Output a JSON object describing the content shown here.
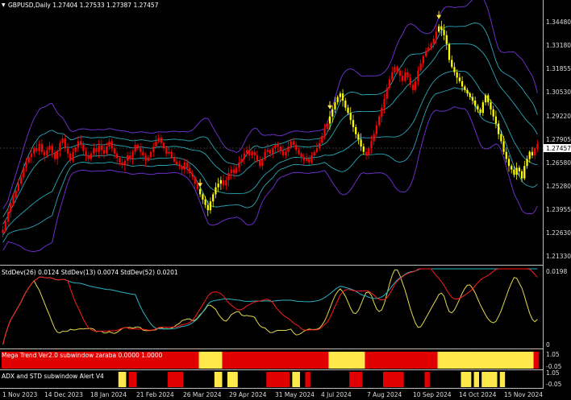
{
  "header": {
    "symbol_info": "GBPUSD,Daily  1.27404 1.27533 1.27387 1.27457"
  },
  "price_scale": {
    "labels": [
      "1.34480",
      "1.33180",
      "1.31855",
      "1.30530",
      "1.29220",
      "1.27905",
      "1.26580",
      "1.25280",
      "1.23955",
      "1.22630",
      "1.21330"
    ],
    "current_price": "1.27457"
  },
  "stddev_panel": {
    "label": "StdDev(26) 0.0124  StdDev(13) 0.0074  StdDev(52) 0.0201",
    "scale_top": "0.0198",
    "scale_bottom": "0"
  },
  "mega_trend_panel": {
    "label": "Mega Trend Ver2.0 subwindow zaraba 0.0000 1.0000",
    "scale_top": "1.05",
    "scale_bottom": "-0.05"
  },
  "adx_panel": {
    "label": "ADX and STD subwindow Alert V4",
    "scale_top": "1.05",
    "scale_bottom": "-0.05"
  },
  "time_axis": {
    "labels": [
      "1 Nov 2023",
      "14 Dec 2023",
      "18 Jan 2024",
      "21 Feb 2024",
      "26 Mar 2024",
      "29 Apr 2024",
      "31 May 2024",
      "4 Jul 2024",
      "7 Aug 2024",
      "10 Sep 2024",
      "14 Oct 2024",
      "15 Nov 2024"
    ]
  },
  "colors": {
    "background": "#000000",
    "bull_candle": "#ff0000",
    "bear_candle": "#ffff00",
    "outer_band": "#6a2fc7",
    "middle_band": "#2aa6b8",
    "inner_band": "#2aa6b8",
    "stddev26": "#ff1a1a",
    "stddev13": "#e0d84a",
    "stddev52": "#2bb3c4",
    "mega_red": "#e00000",
    "mega_yellow": "#ffe94a",
    "price_tag_bg": "#ffffff"
  },
  "chart_data": {
    "type": "candlestick",
    "ylim": [
      1.2075,
      1.3495
    ],
    "closes": [
      1.226,
      1.2305,
      1.236,
      1.241,
      1.244,
      1.248,
      1.252,
      1.2555,
      1.261,
      1.264,
      1.267,
      1.269,
      1.272,
      1.2705,
      1.2745,
      1.27,
      1.268,
      1.271,
      1.2735,
      1.2695,
      1.266,
      1.2705,
      1.275,
      1.2775,
      1.272,
      1.269,
      1.265,
      1.27,
      1.2725,
      1.276,
      1.274,
      1.2705,
      1.268,
      1.266,
      1.269,
      1.272,
      1.27,
      1.2735,
      1.271,
      1.269,
      1.273,
      1.276,
      1.272,
      1.269,
      1.2665,
      1.264,
      1.2625,
      1.265,
      1.268,
      1.266,
      1.27,
      1.274,
      1.272,
      1.27,
      1.268,
      1.265,
      1.267,
      1.27,
      1.273,
      1.276,
      1.278,
      1.275,
      1.272,
      1.269,
      1.27,
      1.267,
      1.2645,
      1.263,
      1.262,
      1.26,
      1.264,
      1.261,
      1.258,
      1.256,
      1.252,
      1.249,
      1.246,
      1.243,
      1.24,
      1.237,
      1.242,
      1.246,
      1.25,
      1.252,
      1.254,
      1.251,
      1.254,
      1.258,
      1.26,
      1.258,
      1.261,
      1.264,
      1.266,
      1.269,
      1.271,
      1.268,
      1.27,
      1.268,
      1.265,
      1.262,
      1.266,
      1.27,
      1.271,
      1.269,
      1.272,
      1.274,
      1.273,
      1.2705,
      1.268,
      1.27,
      1.273,
      1.276,
      1.274,
      1.271,
      1.269,
      1.267,
      1.265,
      1.266,
      1.264,
      1.268,
      1.27,
      1.272,
      1.275,
      1.279,
      1.283,
      1.286,
      1.29,
      1.294,
      1.298,
      1.301,
      1.303,
      1.299,
      1.295,
      1.292,
      1.288,
      1.284,
      1.28,
      1.277,
      1.273,
      1.27,
      1.268,
      1.272,
      1.276,
      1.28,
      1.285,
      1.29,
      1.295,
      1.3,
      1.306,
      1.311,
      1.315,
      1.318,
      1.316,
      1.313,
      1.31,
      1.315,
      1.312,
      1.308,
      1.305,
      1.31,
      1.316,
      1.32,
      1.324,
      1.327,
      1.329,
      1.331,
      1.334,
      1.338,
      1.341,
      1.339,
      1.336,
      1.331,
      1.322,
      1.318,
      1.315,
      1.312,
      1.31,
      1.307,
      1.305,
      1.303,
      1.301,
      1.299,
      1.296,
      1.294,
      1.292,
      1.298,
      1.302,
      1.298,
      1.294,
      1.29,
      1.286,
      1.28,
      1.276,
      1.27,
      1.266,
      1.262,
      1.26,
      1.257,
      1.261,
      1.259,
      1.255,
      1.262,
      1.266,
      1.27,
      1.268,
      1.272,
      1.2746
    ]
  }
}
